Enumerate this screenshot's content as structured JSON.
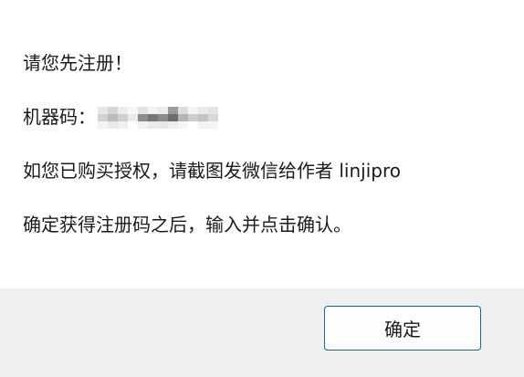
{
  "dialog": {
    "line1": "请您先注册！",
    "machine_code_label": "机器码：",
    "line3": "如您已购买授权，请截图发微信给作者 linjipro",
    "line4": "确定获得注册码之后，输入并点击确认。",
    "ok_label": "确定"
  },
  "colors": {
    "footer_bg": "#f0f0f0",
    "button_border": "#0f6b96",
    "text": "#1a1a1a"
  },
  "machine_code_mosaic": [
    [
      "#e6e6e6",
      "#d6d6d6",
      "#ededed",
      "#f7f7f7",
      "#e2e2e2",
      "#f2f2f2",
      "#ececec",
      "#9a9a9a",
      "#dddddd",
      "#f4f4f4",
      "#e9e9e9",
      "#e4e4e4"
    ],
    [
      "#d2d2d2",
      "#bcbcbc",
      "#cfcfcf",
      "#ebebeb",
      "#8c8c8c",
      "#757575",
      "#8a8a8a",
      "#6c6c6c",
      "#b5b5b5",
      "#cdcdcd",
      "#c4c4c4",
      "#d8d8d8"
    ],
    [
      "#f3f3f3",
      "#e8e8e8",
      "#f0f0f0",
      "#ffffff",
      "#f1f1f1",
      "#eaeaea",
      "#e7e7e7",
      "#ededed",
      "#f6f6f6",
      "#ffffff",
      "#f2f2f2",
      "#f5f5f5"
    ]
  ]
}
